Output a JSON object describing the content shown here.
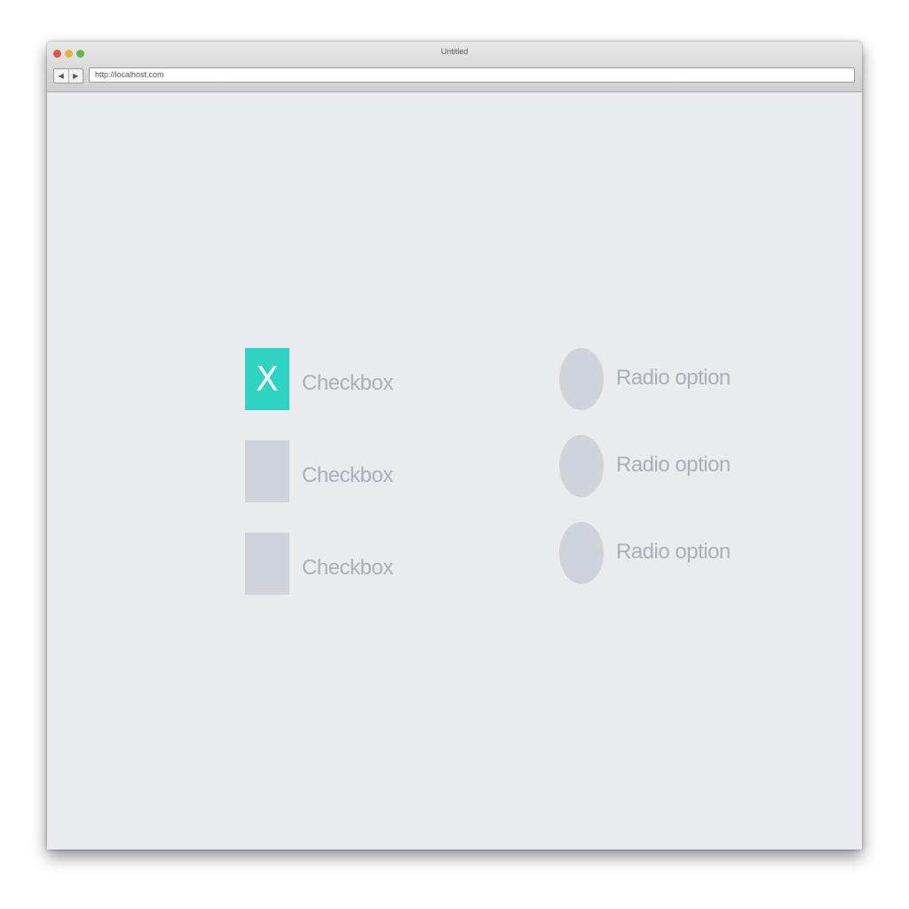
{
  "window": {
    "title": "Untitled",
    "url": "http://localhost.com",
    "nav_back": "◀",
    "nav_forward": "▶"
  },
  "checkboxes": [
    {
      "label": "Checkbox",
      "checked": true,
      "mark": "X"
    },
    {
      "label": "Checkbox",
      "checked": false,
      "mark": ""
    },
    {
      "label": "Checkbox",
      "checked": false,
      "mark": ""
    }
  ],
  "radios": [
    {
      "label": "Radio option",
      "selected": false
    },
    {
      "label": "Radio option",
      "selected": false
    },
    {
      "label": "Radio option",
      "selected": false
    }
  ],
  "colors": {
    "accent": "#2ed3c3",
    "control_idle": "#cfd3da",
    "label_text": "#aab0ba",
    "background": "#e9ebee"
  }
}
